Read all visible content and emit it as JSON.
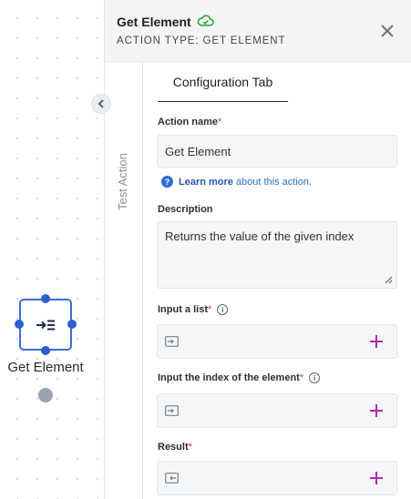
{
  "canvas": {
    "node": {
      "label": "Get Element",
      "icon": "arrow-to-list-icon"
    }
  },
  "panel": {
    "title": "Get Element",
    "status_icon": "cloud-check-icon",
    "action_type": "ACTION TYPE: GET ELEMENT",
    "close_icon": "close-icon",
    "side_tab": "Test Action",
    "collapse_icon": "chevron-left-icon",
    "tab": "Configuration Tab",
    "fields": {
      "action_name": {
        "label": "Action name",
        "required": "*",
        "value": "Get Element"
      },
      "help": {
        "learn_more": "Learn more",
        "rest": "about this action."
      },
      "description": {
        "label": "Description",
        "value": "Returns the value of the given index"
      },
      "input_list": {
        "label": "Input a list",
        "required": "*"
      },
      "input_index": {
        "label": "Input the index of the element",
        "required": "*"
      },
      "result": {
        "label": "Result",
        "required": "*"
      }
    }
  },
  "colors": {
    "accent_blue": "#2b6fd6",
    "plus_magenta": "#b02aa8",
    "cloud_green": "#3aa84a",
    "required_red": "#d23c3c"
  }
}
